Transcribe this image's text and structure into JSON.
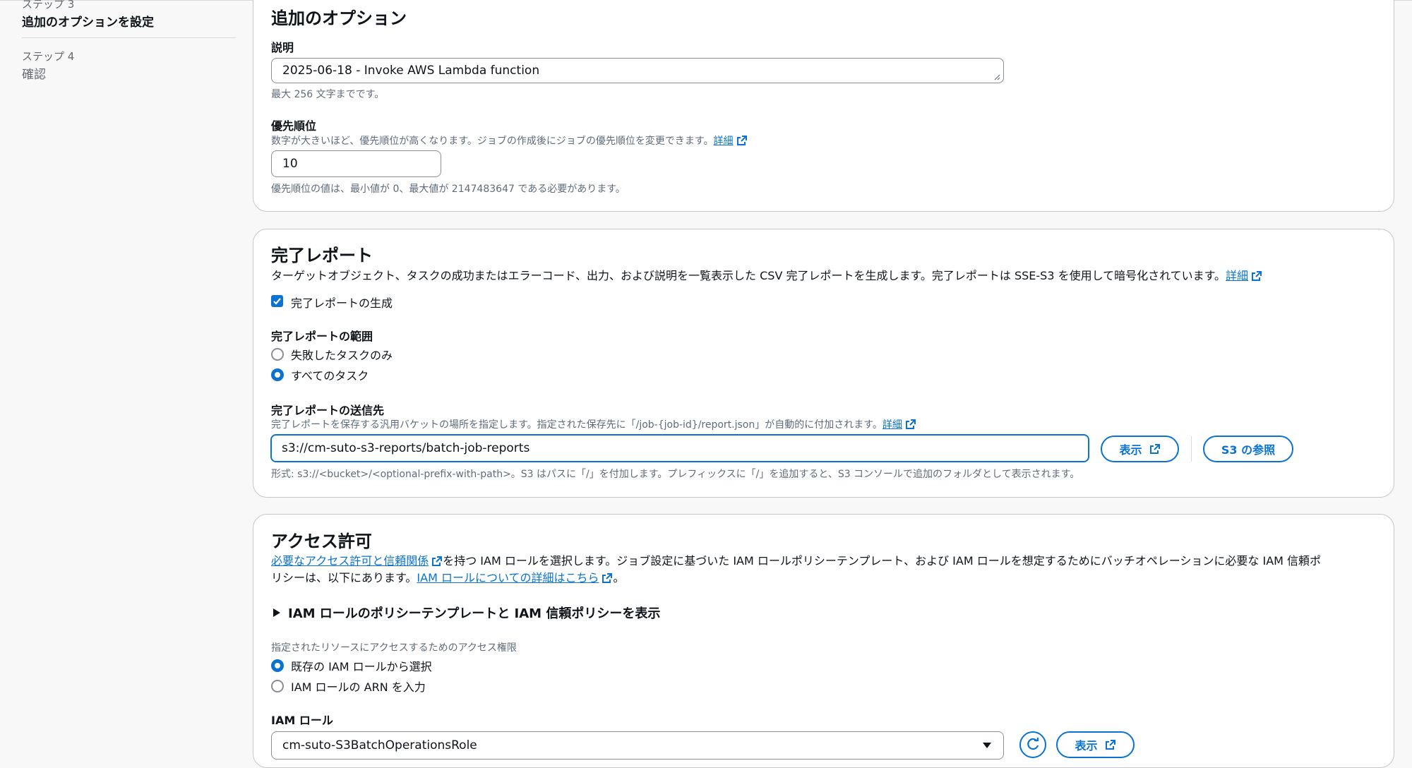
{
  "nav": {
    "step3_caption": "ステップ 3",
    "step3_name": "追加のオプションを設定",
    "step4_caption": "ステップ 4",
    "step4_name": "確認"
  },
  "options": {
    "title": "追加のオプション",
    "description_label": "説明",
    "description_value": "2025-06-18 - Invoke AWS Lambda function",
    "description_hint": "最大 256 文字までです。",
    "priority_label": "優先順位",
    "priority_desc": "数字が大きいほど、優先順位が高くなります。ジョブの作成後にジョブの優先順位を変更できます。",
    "priority_link": "詳細",
    "priority_value": "10",
    "priority_hint": "優先順位の値は、最小値が 0、最大値が 2147483647 である必要があります。"
  },
  "report": {
    "title": "完了レポート",
    "desc": "ターゲットオブジェクト、タスクの成功またはエラーコード、出力、および説明を一覧表示した CSV 完了レポートを生成します。完了レポートは SSE-S3 を使用して暗号化されています。",
    "desc_link": "詳細",
    "generate_label": "完了レポートの生成",
    "generate_checked": true,
    "scope_label": "完了レポートの範囲",
    "scope_options": [
      "失敗したタスクのみ",
      "すべてのタスク"
    ],
    "scope_selected": "すべてのタスク",
    "dest_label": "完了レポートの送信先",
    "dest_desc": "完了レポートを保存する汎用バケットの場所を指定します。指定された保存先に「/job-{job-id}/report.json」が自動的に付加されます。",
    "dest_link": "詳細",
    "dest_value": "s3://cm-suto-s3-reports/batch-job-reports",
    "view_button": "表示",
    "browse_button": "S3 の参照",
    "dest_hint": "形式: s3://<bucket>/<optional-prefix-with-path>。S3 はパスに「/」を付加します。プレフィックスに「/」を追加すると、S3 コンソールで追加のフォルダとして表示されます。"
  },
  "access": {
    "title": "アクセス許可",
    "desc_link1": "必要なアクセス許可と信頼関係",
    "desc_part1": "を持つ IAM ロールを選択します。ジョブ設定に基づいた IAM ロールポリシーテンプレート、および IAM ロールを想定するためにバッチオペレーションに必要な IAM 信頼ポ",
    "desc_part2": "リシーは、以下にあります。",
    "desc_link2": "IAM ロールについての詳細はこちら",
    "desc_end": "。",
    "expander": "IAM ロールのポリシーテンプレートと IAM 信頼ポリシーを表示",
    "perm_label": "指定されたリソースにアクセスするためのアクセス権限",
    "perm_options": [
      "既存の IAM ロールから選択",
      "IAM ロールの ARN を入力"
    ],
    "perm_selected": "既存の IAM ロールから選択",
    "role_label": "IAM ロール",
    "role_value": "cm-suto-S3BatchOperationsRole",
    "view_button": "表示"
  },
  "colors": {
    "accent": "#0972d3",
    "text": "#0f141a",
    "muted": "#5f6b7a",
    "border": "#c6c6cd",
    "background": "#f8f8f8"
  },
  "icons": [
    "external-link-icon",
    "checkmark-icon",
    "caret-right-icon",
    "caret-down-icon",
    "refresh-icon"
  ]
}
